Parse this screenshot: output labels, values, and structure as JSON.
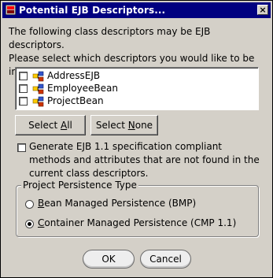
{
  "window": {
    "title": "Potential EJB Descriptors...",
    "close_glyph": "×"
  },
  "intro_text": "The following class descriptors may be EJB descriptors.\nPlease select which descriptors you would like to be\nimported as EJB descriptors.",
  "descriptors": [
    {
      "label": "AddressEJB",
      "checked": false
    },
    {
      "label": "EmployeeBean",
      "checked": false
    },
    {
      "label": "ProjectBean",
      "checked": false
    }
  ],
  "buttons": {
    "select_all_pre": "Select ",
    "select_all_u": "A",
    "select_all_post": "ll",
    "select_none_pre": "Select ",
    "select_none_u": "N",
    "select_none_post": "one",
    "ok": "OK",
    "cancel": "Cancel"
  },
  "generate_option": {
    "label": "Generate EJB 1.1 specification compliant methods and attributes that are not found in the current class descriptors.",
    "checked": false
  },
  "persistence_group": {
    "title": "Project Persistence Type",
    "options": [
      {
        "pre": "",
        "u": "B",
        "post": "ean Managed Persistence (BMP)",
        "selected": false
      },
      {
        "pre": "",
        "u": "C",
        "post": "ontainer Managed Persistence (CMP 1.1)",
        "selected": true
      }
    ]
  },
  "colors": {
    "face": "#d4d0c8",
    "titlebar": "#000080"
  }
}
